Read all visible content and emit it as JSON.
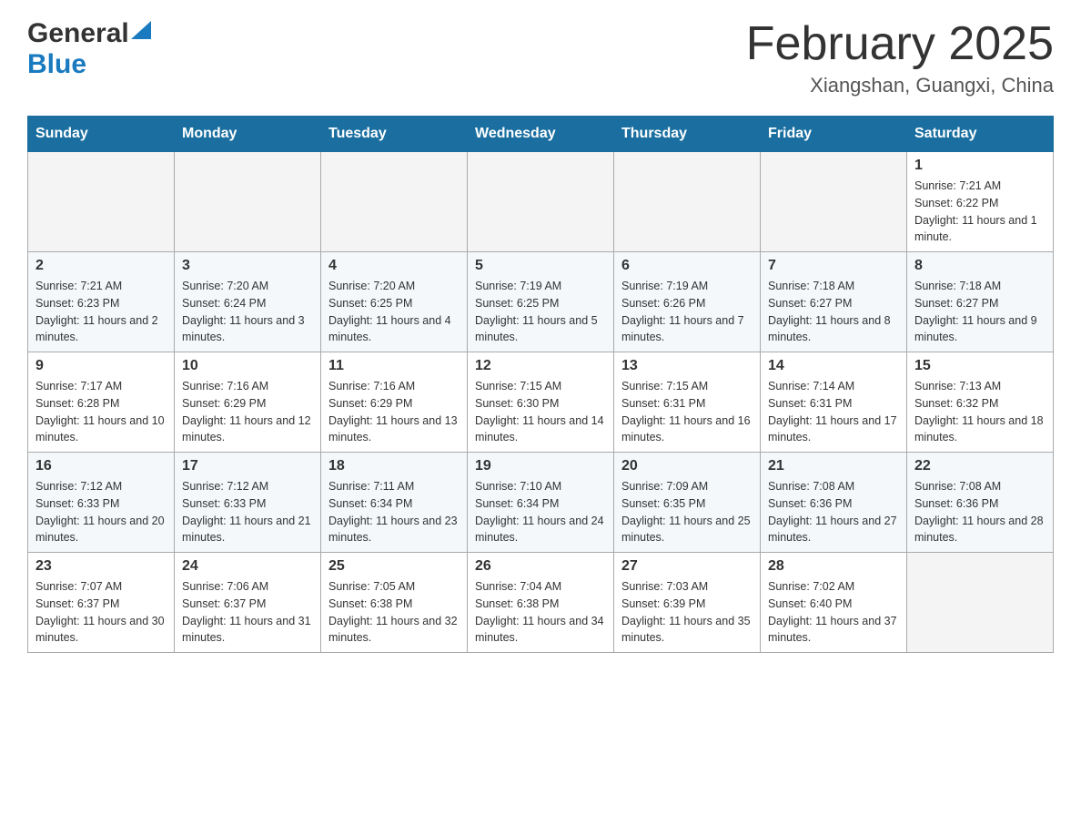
{
  "header": {
    "logo_general": "General",
    "logo_blue": "Blue",
    "title": "February 2025",
    "subtitle": "Xiangshan, Guangxi, China"
  },
  "days_of_week": [
    "Sunday",
    "Monday",
    "Tuesday",
    "Wednesday",
    "Thursday",
    "Friday",
    "Saturday"
  ],
  "weeks": [
    [
      {
        "day": "",
        "info": ""
      },
      {
        "day": "",
        "info": ""
      },
      {
        "day": "",
        "info": ""
      },
      {
        "day": "",
        "info": ""
      },
      {
        "day": "",
        "info": ""
      },
      {
        "day": "",
        "info": ""
      },
      {
        "day": "1",
        "info": "Sunrise: 7:21 AM\nSunset: 6:22 PM\nDaylight: 11 hours and 1 minute."
      }
    ],
    [
      {
        "day": "2",
        "info": "Sunrise: 7:21 AM\nSunset: 6:23 PM\nDaylight: 11 hours and 2 minutes."
      },
      {
        "day": "3",
        "info": "Sunrise: 7:20 AM\nSunset: 6:24 PM\nDaylight: 11 hours and 3 minutes."
      },
      {
        "day": "4",
        "info": "Sunrise: 7:20 AM\nSunset: 6:25 PM\nDaylight: 11 hours and 4 minutes."
      },
      {
        "day": "5",
        "info": "Sunrise: 7:19 AM\nSunset: 6:25 PM\nDaylight: 11 hours and 5 minutes."
      },
      {
        "day": "6",
        "info": "Sunrise: 7:19 AM\nSunset: 6:26 PM\nDaylight: 11 hours and 7 minutes."
      },
      {
        "day": "7",
        "info": "Sunrise: 7:18 AM\nSunset: 6:27 PM\nDaylight: 11 hours and 8 minutes."
      },
      {
        "day": "8",
        "info": "Sunrise: 7:18 AM\nSunset: 6:27 PM\nDaylight: 11 hours and 9 minutes."
      }
    ],
    [
      {
        "day": "9",
        "info": "Sunrise: 7:17 AM\nSunset: 6:28 PM\nDaylight: 11 hours and 10 minutes."
      },
      {
        "day": "10",
        "info": "Sunrise: 7:16 AM\nSunset: 6:29 PM\nDaylight: 11 hours and 12 minutes."
      },
      {
        "day": "11",
        "info": "Sunrise: 7:16 AM\nSunset: 6:29 PM\nDaylight: 11 hours and 13 minutes."
      },
      {
        "day": "12",
        "info": "Sunrise: 7:15 AM\nSunset: 6:30 PM\nDaylight: 11 hours and 14 minutes."
      },
      {
        "day": "13",
        "info": "Sunrise: 7:15 AM\nSunset: 6:31 PM\nDaylight: 11 hours and 16 minutes."
      },
      {
        "day": "14",
        "info": "Sunrise: 7:14 AM\nSunset: 6:31 PM\nDaylight: 11 hours and 17 minutes."
      },
      {
        "day": "15",
        "info": "Sunrise: 7:13 AM\nSunset: 6:32 PM\nDaylight: 11 hours and 18 minutes."
      }
    ],
    [
      {
        "day": "16",
        "info": "Sunrise: 7:12 AM\nSunset: 6:33 PM\nDaylight: 11 hours and 20 minutes."
      },
      {
        "day": "17",
        "info": "Sunrise: 7:12 AM\nSunset: 6:33 PM\nDaylight: 11 hours and 21 minutes."
      },
      {
        "day": "18",
        "info": "Sunrise: 7:11 AM\nSunset: 6:34 PM\nDaylight: 11 hours and 23 minutes."
      },
      {
        "day": "19",
        "info": "Sunrise: 7:10 AM\nSunset: 6:34 PM\nDaylight: 11 hours and 24 minutes."
      },
      {
        "day": "20",
        "info": "Sunrise: 7:09 AM\nSunset: 6:35 PM\nDaylight: 11 hours and 25 minutes."
      },
      {
        "day": "21",
        "info": "Sunrise: 7:08 AM\nSunset: 6:36 PM\nDaylight: 11 hours and 27 minutes."
      },
      {
        "day": "22",
        "info": "Sunrise: 7:08 AM\nSunset: 6:36 PM\nDaylight: 11 hours and 28 minutes."
      }
    ],
    [
      {
        "day": "23",
        "info": "Sunrise: 7:07 AM\nSunset: 6:37 PM\nDaylight: 11 hours and 30 minutes."
      },
      {
        "day": "24",
        "info": "Sunrise: 7:06 AM\nSunset: 6:37 PM\nDaylight: 11 hours and 31 minutes."
      },
      {
        "day": "25",
        "info": "Sunrise: 7:05 AM\nSunset: 6:38 PM\nDaylight: 11 hours and 32 minutes."
      },
      {
        "day": "26",
        "info": "Sunrise: 7:04 AM\nSunset: 6:38 PM\nDaylight: 11 hours and 34 minutes."
      },
      {
        "day": "27",
        "info": "Sunrise: 7:03 AM\nSunset: 6:39 PM\nDaylight: 11 hours and 35 minutes."
      },
      {
        "day": "28",
        "info": "Sunrise: 7:02 AM\nSunset: 6:40 PM\nDaylight: 11 hours and 37 minutes."
      },
      {
        "day": "",
        "info": ""
      }
    ]
  ]
}
